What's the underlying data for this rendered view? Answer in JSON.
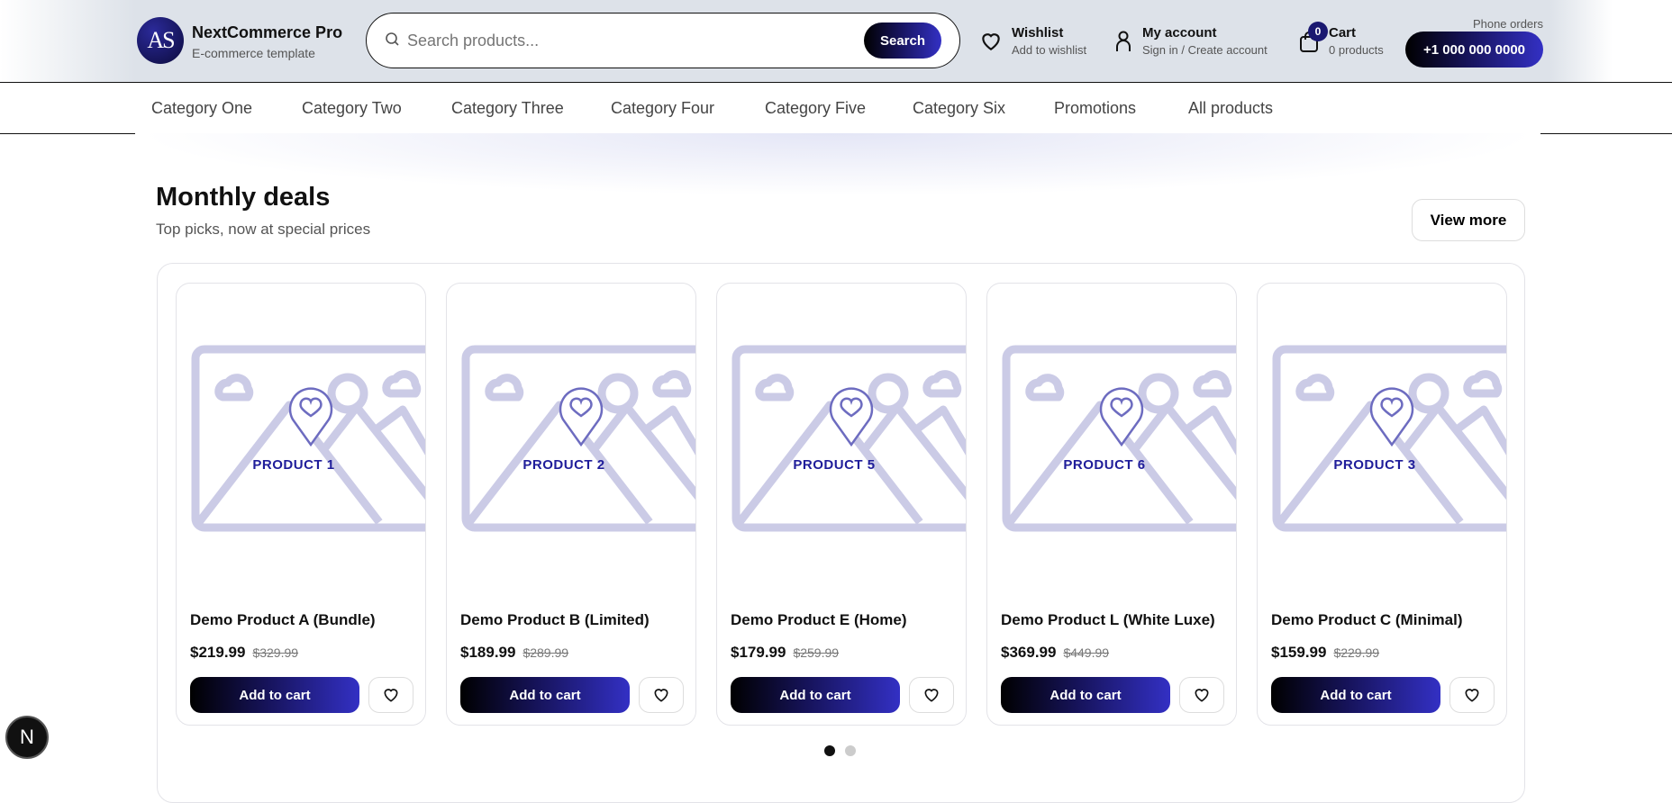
{
  "header": {
    "logo_text": "AS",
    "brand_title": "NextCommerce Pro",
    "brand_subtitle": "E-commerce template",
    "search": {
      "placeholder": "Search products...",
      "button": "Search"
    },
    "wishlist": {
      "title": "Wishlist",
      "subtitle": "Add to wishlist"
    },
    "account": {
      "title": "My account",
      "subtitle": "Sign in / Create account"
    },
    "cart": {
      "title": "Cart",
      "subtitle": "0 products",
      "count": "0"
    },
    "phone": {
      "label": "Phone orders",
      "number": "+1 000 000 0000"
    }
  },
  "nav": [
    "Category One",
    "Category Two",
    "Category Three",
    "Category Four",
    "Category Five",
    "Category Six",
    "Promotions",
    "All products"
  ],
  "section": {
    "title": "Monthly deals",
    "subtitle": "Top picks, now at special prices",
    "view_more": "View more"
  },
  "products": [
    {
      "image_label": "PRODUCT 1",
      "name": "Demo Product A (Bundle)",
      "price": "$219.99",
      "old_price": "$329.99"
    },
    {
      "image_label": "PRODUCT 2",
      "name": "Demo Product B (Limited)",
      "price": "$189.99",
      "old_price": "$289.99"
    },
    {
      "image_label": "PRODUCT 5",
      "name": "Demo Product E (Home)",
      "price": "$179.99",
      "old_price": "$259.99"
    },
    {
      "image_label": "PRODUCT 6",
      "name": "Demo Product L (White Luxe)",
      "price": "$369.99",
      "old_price": "$449.99"
    },
    {
      "image_label": "PRODUCT 3",
      "name": "Demo Product C (Minimal)",
      "price": "$159.99",
      "old_price": "$229.99"
    }
  ],
  "add_to_cart": "Add to cart",
  "carousel": {
    "pages": 2,
    "active_page": 1
  },
  "dev_badge": "N"
}
